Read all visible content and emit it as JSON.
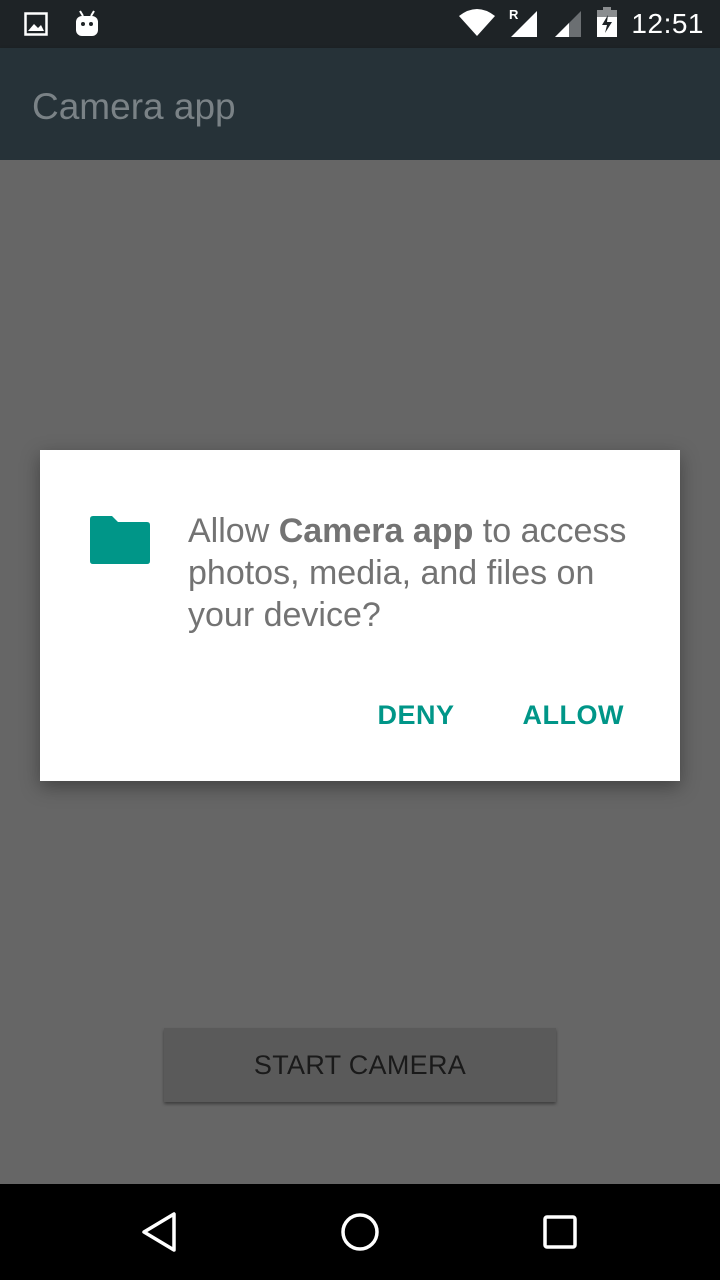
{
  "status_bar": {
    "time": "12:51",
    "icons_left": [
      "image-notification-icon",
      "android-notification-icon"
    ],
    "icons_right": [
      "wifi-icon",
      "signal-roaming-icon",
      "signal-icon",
      "battery-charging-icon"
    ],
    "roaming_label": "R"
  },
  "app_bar": {
    "title": "Camera app"
  },
  "dialog": {
    "icon": "folder-icon",
    "message_prefix": "Allow ",
    "app_name": "Camera app",
    "message_suffix": " to access photos, media, and files on your device?",
    "deny_label": "DENY",
    "allow_label": "ALLOW",
    "accent_color": "#009688"
  },
  "main": {
    "start_camera_label": "START CAMERA"
  },
  "nav_bar": {
    "icons": [
      "back-icon",
      "home-icon",
      "recents-icon"
    ]
  },
  "colors": {
    "status_bar": "#1e2326",
    "app_bar": "#263238",
    "scrim": "#666666",
    "accent": "#009688"
  }
}
